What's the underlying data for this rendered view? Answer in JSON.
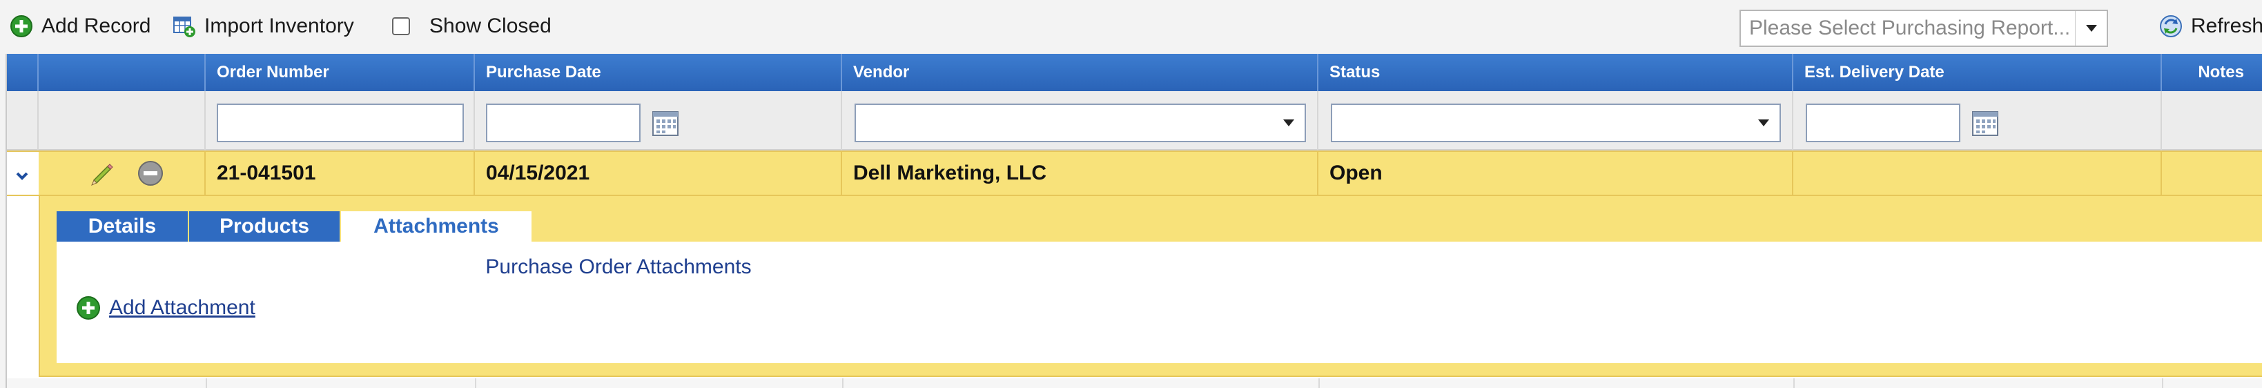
{
  "toolbar": {
    "add_record": "Add Record",
    "import_inventory": "Import Inventory",
    "show_closed": "Show Closed",
    "report_placeholder": "Please Select Purchasing Report...",
    "refresh": "Refresh"
  },
  "grid": {
    "columns": [
      "Order Number",
      "Purchase Date",
      "Vendor",
      "Status",
      "Est. Delivery Date",
      "Notes"
    ],
    "rows": [
      {
        "order_number": "21-041501",
        "purchase_date": "04/15/2021",
        "vendor": "Dell Marketing, LLC",
        "status": "Open",
        "est_delivery_date": "",
        "notes": ""
      }
    ]
  },
  "detail": {
    "tabs": [
      "Details",
      "Products",
      "Attachments"
    ],
    "active_tab": "Attachments",
    "panel_title": "Purchase Order Attachments",
    "add_attachment": "Add Attachment"
  },
  "colors": {
    "header_blue": "#2a63b7",
    "row_highlight": "#f8e27a",
    "link_blue": "#1f3f8f",
    "add_green": "#2e9a2e"
  },
  "icons": {
    "add_record": "plus-circle-icon",
    "import_inventory": "table-import-icon",
    "refresh": "refresh-icon",
    "expand": "chevron-down-icon",
    "edit": "pencil-icon",
    "delete": "minus-circle-icon",
    "calendar": "calendar-icon",
    "add_attachment": "plus-circle-icon"
  }
}
